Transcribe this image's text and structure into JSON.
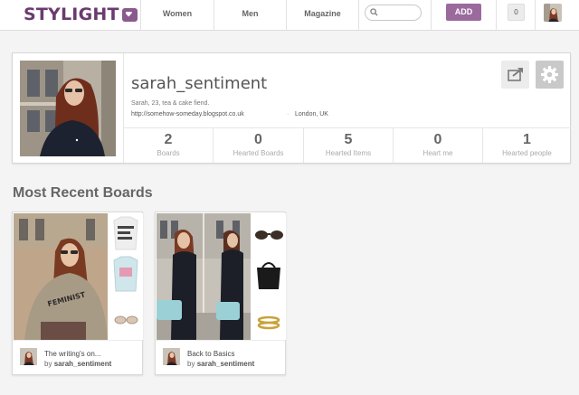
{
  "header": {
    "brand": "STYLIGHT",
    "nav": [
      {
        "label": "Women"
      },
      {
        "label": "Men"
      },
      {
        "label": "Magazine"
      }
    ],
    "search": {
      "value": "",
      "placeholder": ""
    },
    "add_label": "ADD",
    "notification_count": "0"
  },
  "profile": {
    "username": "sarah_sentiment",
    "bio": "Sarah, 23, tea & cake fiend.",
    "url": "http://somehow-someday.blogspot.co.uk",
    "separator": "·",
    "location": "London, UK",
    "stats": [
      {
        "value": "2",
        "label": "Boards"
      },
      {
        "value": "0",
        "label": "Hearted Boards"
      },
      {
        "value": "5",
        "label": "Hearted Items"
      },
      {
        "value": "0",
        "label": "Heart me"
      },
      {
        "value": "1",
        "label": "Hearted people"
      }
    ]
  },
  "recent_boards": {
    "title": "Most Recent Boards",
    "by_prefix": "by",
    "boards": [
      {
        "title": "The writing's on...",
        "author": "sarah_sentiment"
      },
      {
        "title": "Back to Basics",
        "author": "sarah_sentiment"
      }
    ]
  },
  "colors": {
    "brand": "#6a3b6f",
    "accent": "#9a6a9d",
    "background": "#f4f4f4"
  },
  "icons": {
    "share": "share-arrow-icon",
    "settings": "gear-icon",
    "search": "search-icon"
  }
}
